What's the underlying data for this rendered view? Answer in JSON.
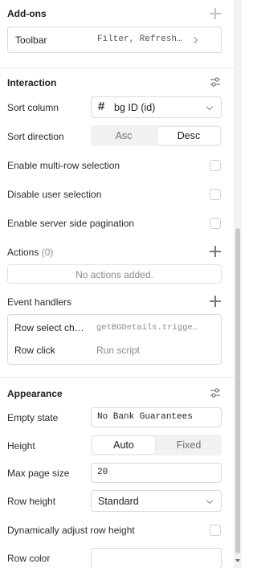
{
  "addons": {
    "title": "Add-ons",
    "toolbar_label": "Toolbar",
    "toolbar_value": "Filter, Refresh…"
  },
  "interaction": {
    "title": "Interaction",
    "sort_column_label": "Sort column",
    "sort_column_value": "bg ID (id)",
    "sort_direction_label": "Sort direction",
    "sort_asc": "Asc",
    "sort_desc": "Desc",
    "sort_selected": "Desc",
    "multi_row_label": "Enable multi-row selection",
    "disable_user_selection_label": "Disable user selection",
    "server_pagination_label": "Enable server side pagination",
    "actions_label": "Actions",
    "actions_count": "(0)",
    "no_actions_text": "No actions added.",
    "event_handlers_label": "Event handlers",
    "event_handlers": [
      {
        "event": "Row select ch…",
        "action": "getBGDetails.trigge…"
      },
      {
        "event": "Row click",
        "action": "Run script"
      }
    ]
  },
  "appearance": {
    "title": "Appearance",
    "empty_state_label": "Empty state",
    "empty_state_value": "No Bank Guarantees",
    "height_label": "Height",
    "height_auto": "Auto",
    "height_fixed": "Fixed",
    "height_selected": "Auto",
    "max_page_size_label": "Max page size",
    "max_page_size_value": "20",
    "row_height_label": "Row height",
    "row_height_value": "Standard",
    "dynamic_row_height_label": "Dynamically adjust row height",
    "row_color_label": "Row color",
    "row_color_value": ""
  },
  "icons": {
    "add": "plus-icon",
    "settings": "sliders-icon",
    "hash": "hash-icon",
    "chevron_down": "chevron-down-icon",
    "chevron_right": "chevron-right-icon"
  },
  "colors": {
    "border": "#d9d9d9",
    "segment_bg": "#f1f1f1",
    "muted_text": "#8a8a8a"
  }
}
